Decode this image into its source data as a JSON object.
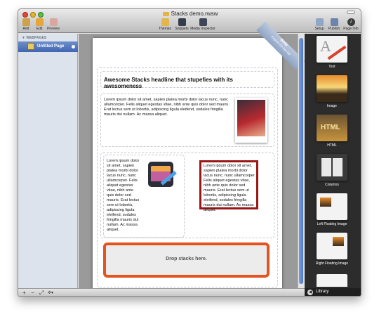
{
  "window": {
    "title": "Stacks demo.rwsw",
    "toolbar_left": [
      {
        "label": "Add",
        "icon": "add-icon"
      },
      {
        "label": "Edit",
        "icon": "edit-icon"
      },
      {
        "label": "Preview",
        "icon": "preview-icon"
      }
    ],
    "toolbar_center": [
      {
        "label": "Themes",
        "icon": "themes-icon"
      },
      {
        "label": "Snippets",
        "icon": "snippets-icon"
      },
      {
        "label": "Media Inspector",
        "icon": "media-inspector-icon"
      }
    ],
    "toolbar_right": [
      {
        "label": "Setup",
        "icon": "setup-icon"
      },
      {
        "label": "Publish",
        "icon": "publish-icon"
      },
      {
        "label": "Page Info",
        "icon": "info-icon"
      }
    ]
  },
  "sidebar": {
    "header": "WEBPAGES",
    "pages": [
      {
        "label": "Untitled Page"
      }
    ]
  },
  "page": {
    "ribbon": "Beta",
    "ribbon_sub": "Expires 04-Jan-09",
    "headline": "Awesome Stacks headline that stupefies with its awesomeness",
    "para_image": "Lorem ipsum dolor sit amet, sapien platea morbi dolor lacus nunc, nunc ullamcorper. Felis aliquet egestas vitae, nibh ante quis dolor sed mauris. Erat lectus sem ut lobortis, adipiscing ligula eleifend, sodales fringilla mauris dui nullam. Ac massa aliquet.",
    "col_left_text": "Lorem ipsum dolor sit amet, sapien platea morbi dolor lacus nunc, nunc ullamcorper. Felis aliquet egestas vitae, nibh ante quis dolor sed mauris. Erat lectus sem ut lobortis, adipiscing ligula eleifend, sodales fringilla mauris dui nullam. Ac massa aliquet.",
    "col_right_text": "Lorem ipsum dolor sit amet, sapien platea morbi dolor lacus nunc, nunc ullamcorper. Felis aliquet egestas vitae, nibh ante quis dolor sed mauris. Erat lectus sem ut lobortis, adipiscing ligula eleifend, sodales fringilla mauris dui nullam. Ac massa aliquet.",
    "drop_label": "Drop stacks here."
  },
  "library": {
    "items": [
      {
        "label": "Text"
      },
      {
        "label": "Image"
      },
      {
        "label": "HTML"
      },
      {
        "label": "Columns"
      },
      {
        "label": "Left Floating Image"
      },
      {
        "label": "Right Floating Image"
      }
    ],
    "footer": "Library"
  },
  "bottombar": {
    "add": "+",
    "remove": "−",
    "expand": "⤢",
    "settings": "✲▾"
  },
  "colors": {
    "selection": "#3f66b3",
    "drop_border": "#e5531f",
    "red_frame": "#9b1616"
  }
}
